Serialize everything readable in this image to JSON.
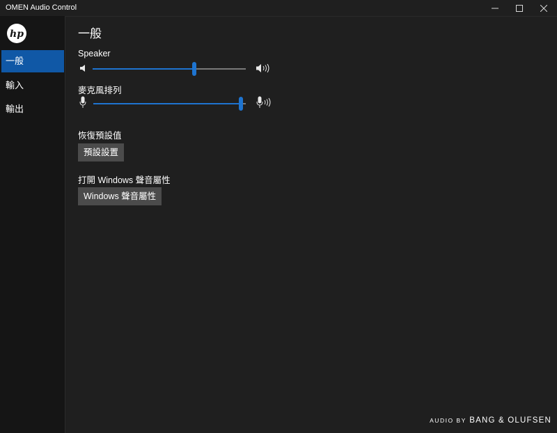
{
  "window": {
    "title": "OMEN Audio Control"
  },
  "sidebar": {
    "logo": "hp",
    "items": [
      {
        "label": "一般",
        "active": true
      },
      {
        "label": "輸入",
        "active": false
      },
      {
        "label": "輸出",
        "active": false
      }
    ]
  },
  "main": {
    "title": "一般",
    "speaker": {
      "label": "Speaker",
      "level": 0.67
    },
    "mic_array": {
      "label": "麥克風排列",
      "level": 0.98
    },
    "reset": {
      "heading": "恢復預設值",
      "button_label": "預設設置"
    },
    "windows_sound": {
      "heading": "打開 Windows 聲音屬性",
      "button_label": "Windows 聲音屬性"
    }
  },
  "footer": {
    "brand_small": "AUDIO BY",
    "brand_big": "BANG & OLUFSEN"
  },
  "colors": {
    "accent": "#1058a6",
    "slider": "#1e74d0",
    "background": "#1f1f1f"
  }
}
